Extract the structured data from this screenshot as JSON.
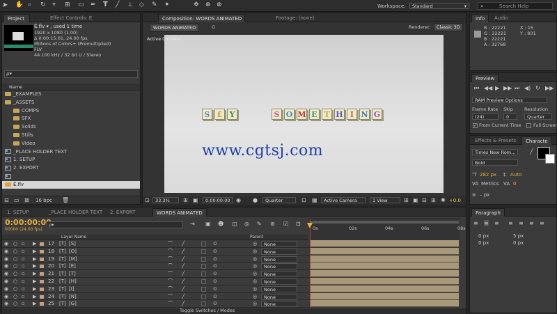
{
  "workspace": {
    "label": "Workspace:",
    "value": "Standard",
    "search_placeholder": "Search Help"
  },
  "project": {
    "tab": "Project",
    "tab2": "Effect Controls: É",
    "file_name": "É.flv ▾ , used 1 time",
    "details": [
      "1920 x 1080 (1.00)",
      "Δ 0:00:15:01, 24.00 fps",
      "Millions of Colors+ (Premultiplied)",
      "FLV",
      "44.100 kHz / 32 bit U / Stereo"
    ],
    "search_placeholder": "ρ▾",
    "col_name": "Name",
    "items": [
      {
        "name": "_EXAMPLES",
        "type": "folder",
        "indent": 0
      },
      {
        "name": "_ASSETS",
        "type": "folder",
        "indent": 0
      },
      {
        "name": "COMPS",
        "type": "folder",
        "indent": 1
      },
      {
        "name": "SFX",
        "type": "folder",
        "indent": 1
      },
      {
        "name": "Solids",
        "type": "folder",
        "indent": 1
      },
      {
        "name": "Stills",
        "type": "folder",
        "indent": 1
      },
      {
        "name": "Video",
        "type": "folder",
        "indent": 1
      },
      {
        "name": "_PLACE HOLDER TEXT",
        "type": "comp",
        "indent": 0
      },
      {
        "name": "1. SETUP",
        "type": "comp",
        "indent": 0
      },
      {
        "name": "2. EXPORT",
        "type": "comp",
        "indent": 0
      },
      {
        "name": "",
        "type": "comp",
        "indent": 0
      },
      {
        "name": "É.flv",
        "type": "footage",
        "indent": 0
      }
    ],
    "bpc": "16 bpc"
  },
  "composition": {
    "tab": "Composition: WORDS ANIMATED",
    "footage_tab": "Footage: (none)",
    "comp_tab": "WORDS ANIMATED",
    "comp_tab2": "G",
    "renderer_label": "Renderer:",
    "renderer": "Classic 3D",
    "active_camera": "Active Camera",
    "blocks": [
      "S",
      "£",
      "Y",
      "S",
      "O",
      "M",
      "E",
      "T",
      "H",
      "I",
      "N",
      "G"
    ],
    "block_colors": [
      "#5a8ac8",
      "#c89a3a",
      "#3a8a5a",
      "#c85a9a",
      "#4a8ac8",
      "#c83a3a",
      "#3a9a6a",
      "#c8a83a",
      "#5a5ac8",
      "#c86a3a",
      "#3a7ab8",
      "#9a4ac8"
    ],
    "watermark": "www.cgtsj.com",
    "zoom": "33.3%",
    "timecode": "0:00:00:00",
    "resolution": "Quarter",
    "camera": "Active Camera",
    "view": "1 View",
    "exposure": "+0.0"
  },
  "timeline": {
    "tabs": [
      "1. SETUP",
      "_PLACE HOLDER TEXT",
      "2. EXPORT",
      "WORDS ANIMATED"
    ],
    "timecode": "0:00:00:00",
    "fps": "00000 (24.00 fps)",
    "search_placeholder": "ρ▾",
    "col_layer": "Layer Name",
    "col_parent": "Parent",
    "ruler": [
      "0s",
      "02s",
      "04s",
      "06s",
      "08s"
    ],
    "layers": [
      {
        "num": "17",
        "name": "[S]",
        "parent": "None"
      },
      {
        "num": "18",
        "name": "[O]",
        "parent": "None"
      },
      {
        "num": "19",
        "name": "[M]",
        "parent": "None"
      },
      {
        "num": "20",
        "name": "[É]",
        "parent": "None"
      },
      {
        "num": "21",
        "name": "[T]",
        "parent": "None"
      },
      {
        "num": "22",
        "name": "[H]",
        "parent": "None"
      },
      {
        "num": "23",
        "name": "[I]",
        "parent": "None"
      },
      {
        "num": "24",
        "name": "[N]",
        "parent": "None"
      },
      {
        "num": "25",
        "name": "[G]",
        "parent": "None"
      }
    ],
    "toggle_label": "Toggle Switches / Modes"
  },
  "info": {
    "tab": "Info",
    "tab2": "Audio",
    "r": "R : 22221",
    "g": "G : 22221",
    "b": "B : 22221",
    "a": "A : 32768",
    "x": "X : 15",
    "y": "Y : 831"
  },
  "preview": {
    "tab": "Preview",
    "ram_options": "RAM Preview Options",
    "frame_rate_label": "Frame Rate",
    "skip_label": "Skip",
    "resolution_label": "Resolution",
    "frame_rate": "(24)",
    "skip": "0",
    "resolution": "Quarter",
    "from_current": "From Current Time",
    "full_screen": "Full Screen"
  },
  "effects": {
    "tab": "Effects & Presets",
    "tab2": "Characte"
  },
  "character": {
    "font": "Times New Rom...",
    "style": "Bold",
    "size": "282 px",
    "leading": "Auto",
    "kerning": "Metrics",
    "tracking": "0",
    "px": "– px"
  },
  "paragraph": {
    "tab": "Paragraph",
    "indent_left": "0 px",
    "indent_right": "0 px",
    "space_before": "5 px",
    "space_after": "0 px"
  }
}
